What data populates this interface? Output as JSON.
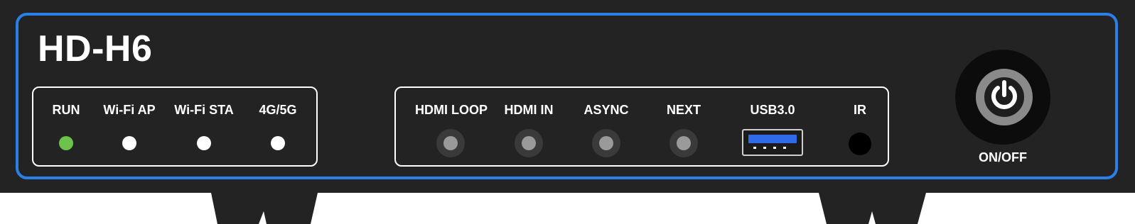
{
  "device": {
    "model": "HD-H6",
    "accent_color": "#2a7fe8"
  },
  "indicators": [
    {
      "label": "RUN",
      "color": "#6cc24a"
    },
    {
      "label": "Wi-Fi AP",
      "color": "#ffffff"
    },
    {
      "label": "Wi-Fi STA",
      "color": "#ffffff"
    },
    {
      "label": "4G/5G",
      "color": "#ffffff"
    }
  ],
  "ports": {
    "hdmi_loop": "HDMI LOOP",
    "hdmi_in": "HDMI IN",
    "async": "ASYNC",
    "next": "NEXT",
    "usb": "USB3.0",
    "ir": "IR"
  },
  "power": {
    "label": "ON/OFF",
    "icon": "power-icon"
  }
}
